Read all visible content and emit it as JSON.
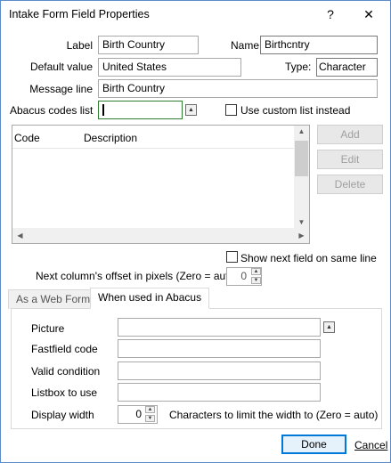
{
  "window": {
    "title": "Intake Form Field Properties",
    "help_glyph": "?",
    "close_glyph": "✕"
  },
  "fields": {
    "label": {
      "label": "Label",
      "value": "Birth Country"
    },
    "name": {
      "label": "Name",
      "value": "Birthcntry"
    },
    "default_value": {
      "label": "Default value",
      "value": "United States"
    },
    "type": {
      "label": "Type:",
      "value": "Character"
    },
    "message_line": {
      "label": "Message line",
      "value": "Birth Country"
    },
    "abacus_codes_list": {
      "label": "Abacus codes list",
      "value": ""
    }
  },
  "use_custom_list": {
    "label": "Use custom list instead",
    "checked": false
  },
  "codes_table": {
    "columns": [
      "Code",
      "Description"
    ],
    "rows": []
  },
  "list_buttons": {
    "add": "Add",
    "edit": "Edit",
    "delete": "Delete"
  },
  "show_next_field": {
    "label": "Show next field on same line",
    "checked": false
  },
  "next_column_offset": {
    "label": "Next column's offset in pixels (Zero = auto)",
    "value": "0"
  },
  "tabs": [
    {
      "label": "As a Web Form",
      "active": false
    },
    {
      "label": "When used in Abacus",
      "active": true
    }
  ],
  "abacus_tab": {
    "picture": {
      "label": "Picture",
      "value": ""
    },
    "fastfield_code": {
      "label": "Fastfield code",
      "value": ""
    },
    "valid_condition": {
      "label": "Valid condition",
      "value": ""
    },
    "listbox_to_use": {
      "label": "Listbox to use",
      "value": ""
    },
    "display_width": {
      "label": "Display width",
      "value": "0",
      "hint": "Characters to limit the width to (Zero = auto)"
    }
  },
  "footer": {
    "done": "Done",
    "cancel": "Cancel"
  }
}
